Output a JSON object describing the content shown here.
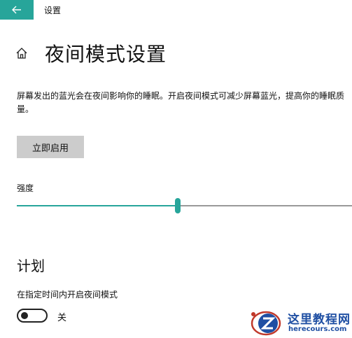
{
  "titlebar": {
    "back_icon": "arrow-left-icon",
    "app_title": "设置",
    "accent_color": "#27a59a"
  },
  "header": {
    "home_icon": "home-icon",
    "title": "夜间模式设置"
  },
  "description": "屏幕发出的蓝光会在夜间影响你的睡眠。开启夜间模式可减少屏幕蓝光，提高你的睡眠质量。",
  "enable_button": {
    "label": "立即启用"
  },
  "strength": {
    "label": "强度",
    "value_fraction": 0.48
  },
  "schedule": {
    "heading": "计划",
    "label": "在指定时间内开启夜间模式",
    "toggle_state": "关",
    "toggle_on": false
  },
  "watermark": {
    "text_main": "这里教程网",
    "text_sub": "herecours.com",
    "color": "#1f4fa3"
  }
}
